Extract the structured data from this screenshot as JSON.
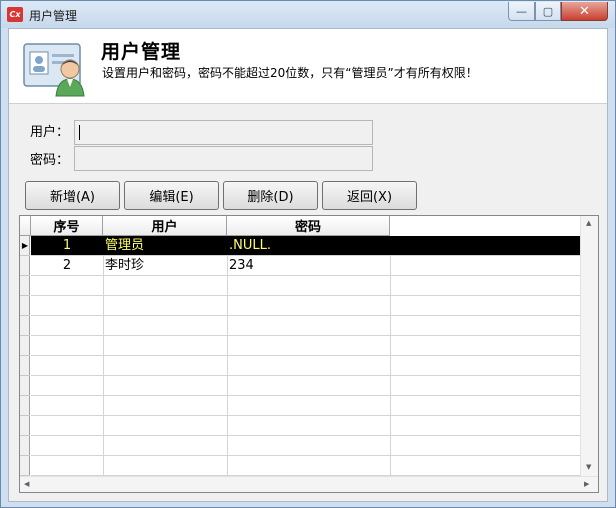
{
  "window": {
    "title": "用户管理",
    "app_icon_text": "Cx",
    "controls": {
      "minimize": "—",
      "maximize": "▢",
      "close": "✕"
    }
  },
  "header": {
    "title": "用户管理",
    "description": "设置用户和密码，密码不能超过20位数，只有“管理员”才有所有权限！",
    "icon": "user-card-icon"
  },
  "form": {
    "user_label": "用户：",
    "user_value": "",
    "password_label": "密码：",
    "password_value": ""
  },
  "buttons": {
    "add": "新增(A)",
    "edit": "编辑(E)",
    "delete": "删除(D)",
    "back": "返回(X)"
  },
  "table": {
    "columns": [
      "序号",
      "用户",
      "密码"
    ],
    "rows": [
      {
        "index": "1",
        "user": "管理员",
        "password": ".NULL."
      },
      {
        "index": "2",
        "user": "李时珍",
        "password": "234"
      }
    ],
    "selected_row": 0,
    "row_indicator": "▶"
  },
  "colors": {
    "selection_bg": "#000000",
    "selection_text": "#ffff66",
    "window_frame": "#cfdfef",
    "close_button": "#c84030"
  }
}
